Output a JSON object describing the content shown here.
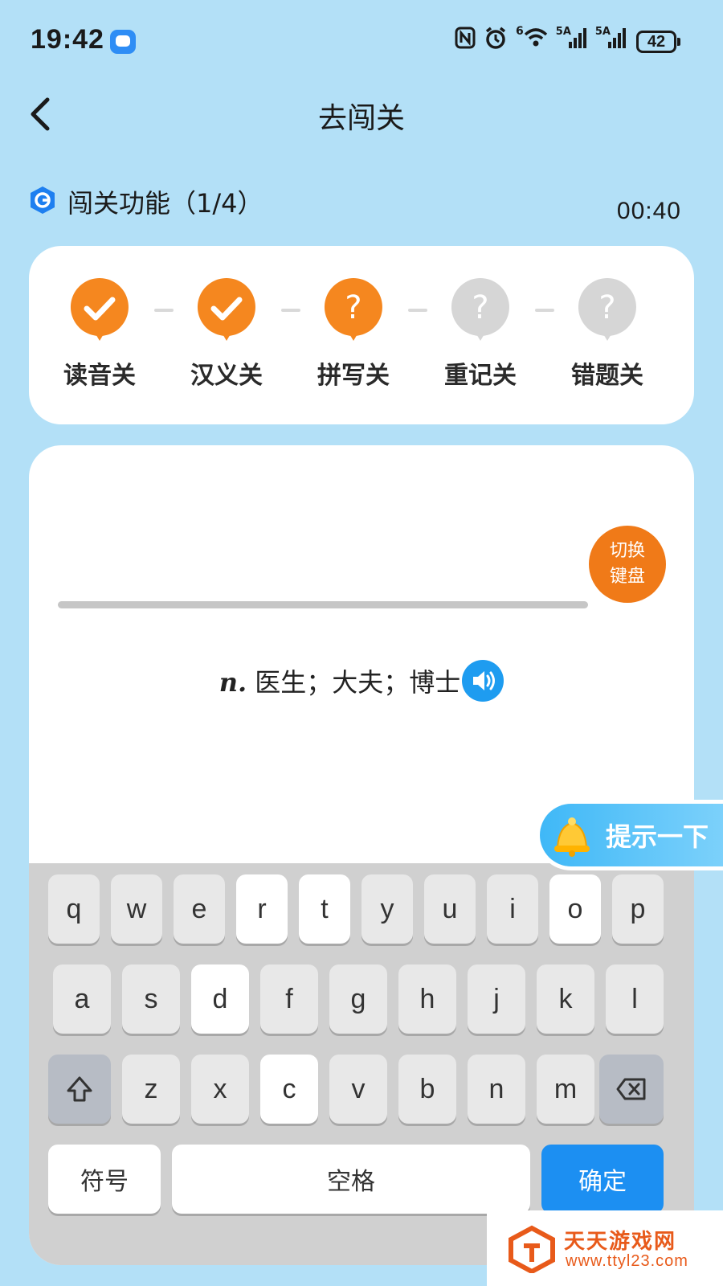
{
  "status": {
    "time": "19:42",
    "net1": "5A",
    "net2": "5A",
    "wifi_badge": "6",
    "battery": "42"
  },
  "header": {
    "title": "去闯关"
  },
  "section": {
    "title": "闯关功能（1/4）",
    "timer": "00:40"
  },
  "stages": [
    {
      "label": "读音关",
      "state": "done"
    },
    {
      "label": "汉义关",
      "state": "done"
    },
    {
      "label": "拼写关",
      "state": "current"
    },
    {
      "label": "重记关",
      "state": "locked"
    },
    {
      "label": "错题关",
      "state": "locked"
    }
  ],
  "quiz": {
    "switch_line1": "切换",
    "switch_line2": "键盘",
    "pos": "n.",
    "meaning": " 医生；大夫；博士"
  },
  "hint": {
    "label": "提示一下"
  },
  "keyboard": {
    "row1": [
      "q",
      "w",
      "e",
      "r",
      "t",
      "y",
      "u",
      "i",
      "o",
      "p"
    ],
    "row2": [
      "a",
      "s",
      "d",
      "f",
      "g",
      "h",
      "j",
      "k",
      "l"
    ],
    "row3": [
      "z",
      "x",
      "c",
      "v",
      "b",
      "n",
      "m"
    ],
    "symbols": "符号",
    "space": "空格",
    "confirm": "确定"
  },
  "watermark": {
    "name": "天天游戏网",
    "url": "www.ttyl23.com"
  },
  "colors": {
    "background": "#b3e0f7",
    "accent": "#f5871f",
    "locked": "#d6d6d6",
    "primary": "#1c8ff2"
  }
}
